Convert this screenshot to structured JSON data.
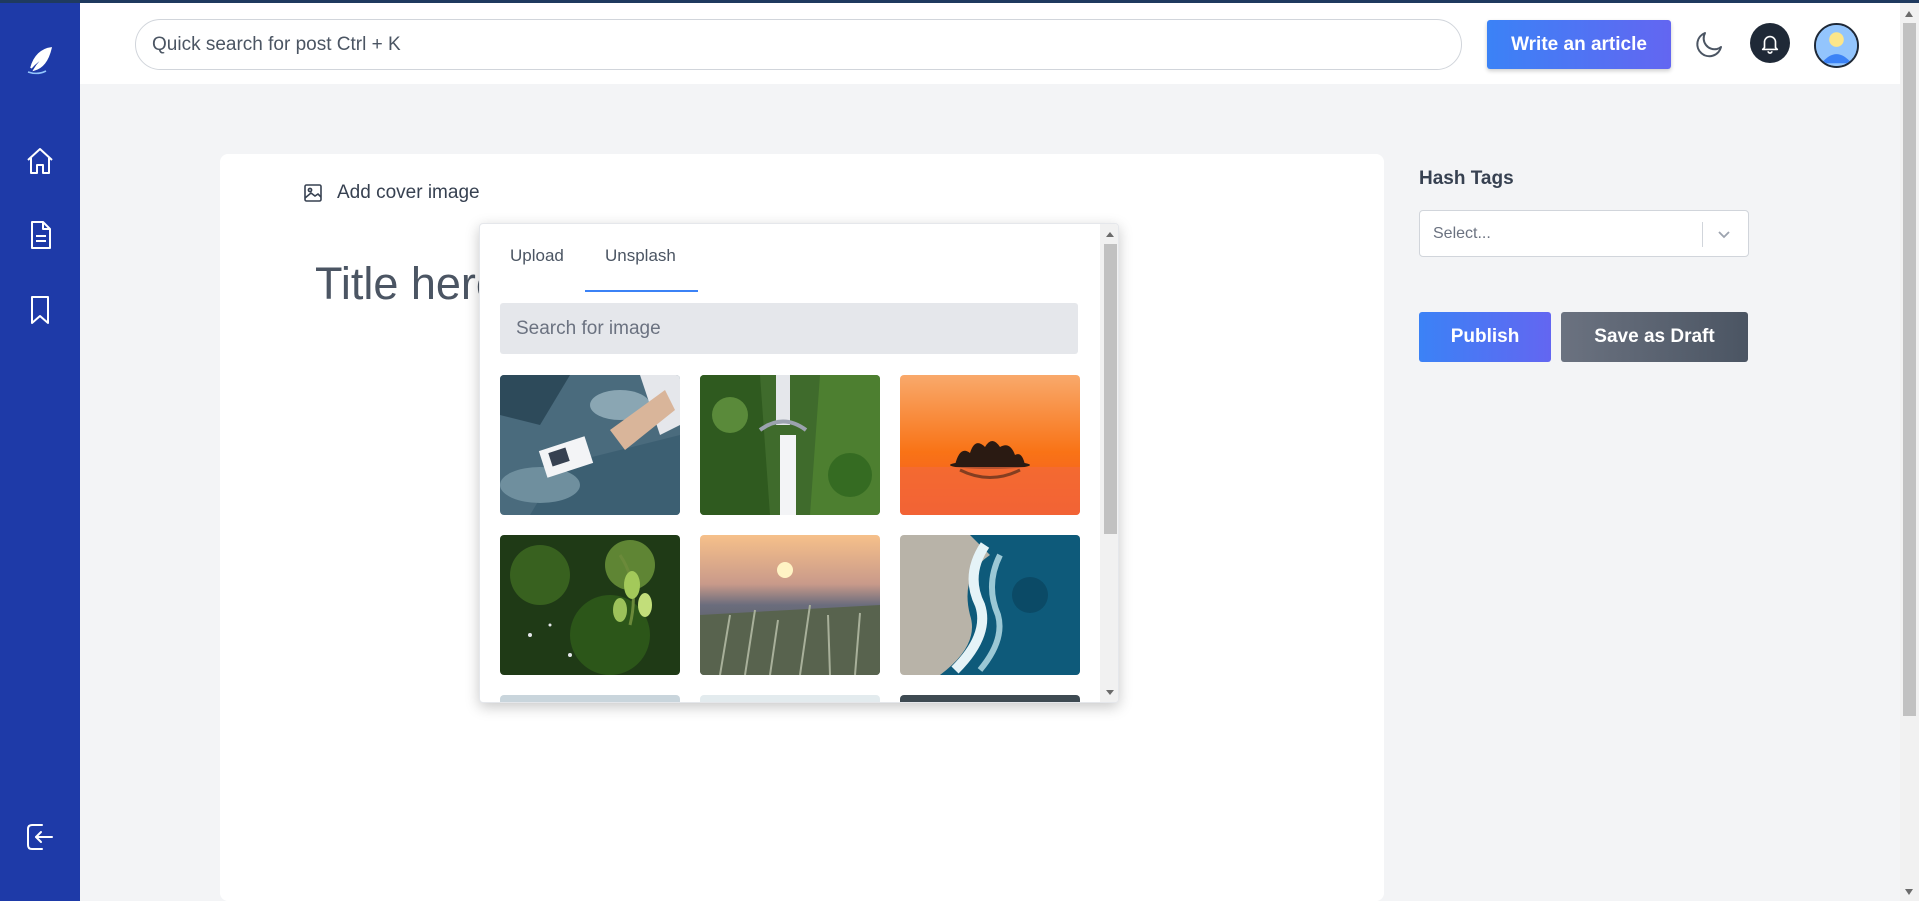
{
  "header": {
    "search_placeholder": "Quick search for post Ctrl + K",
    "write_button": "Write an article",
    "theme_icon": "moon-icon",
    "notification_icon": "bell-icon",
    "avatar_icon": "user-avatar-icon"
  },
  "sidebar": {
    "items": [
      {
        "icon": "feather-logo-icon"
      },
      {
        "icon": "home-icon"
      },
      {
        "icon": "document-icon"
      },
      {
        "icon": "bookmark-icon"
      },
      {
        "icon": "logout-icon"
      }
    ]
  },
  "editor": {
    "cover_label": "Add cover image",
    "title_placeholder": "Title here..."
  },
  "image_picker": {
    "tabs": [
      {
        "label": "Upload",
        "active": false
      },
      {
        "label": "Unsplash",
        "active": true
      }
    ],
    "search_placeholder": "Search for image",
    "images": [
      {
        "icon": "photo-hand-on-rocks-icon"
      },
      {
        "icon": "photo-waterfall-icon"
      },
      {
        "icon": "photo-sunset-island-icon"
      },
      {
        "icon": "photo-green-leaves-icon"
      },
      {
        "icon": "photo-grass-sunset-icon"
      },
      {
        "icon": "photo-ocean-wave-icon"
      }
    ]
  },
  "sidebar_right": {
    "hash_tags_label": "Hash Tags",
    "select_placeholder": "Select...",
    "publish_button": "Publish",
    "draft_button": "Save as Draft"
  },
  "colors": {
    "sidebar_bg": "#1e3aa8",
    "accent_gradient_start": "#3b82f6",
    "accent_gradient_end": "#6366f1",
    "draft_bg": "#4b5563"
  }
}
